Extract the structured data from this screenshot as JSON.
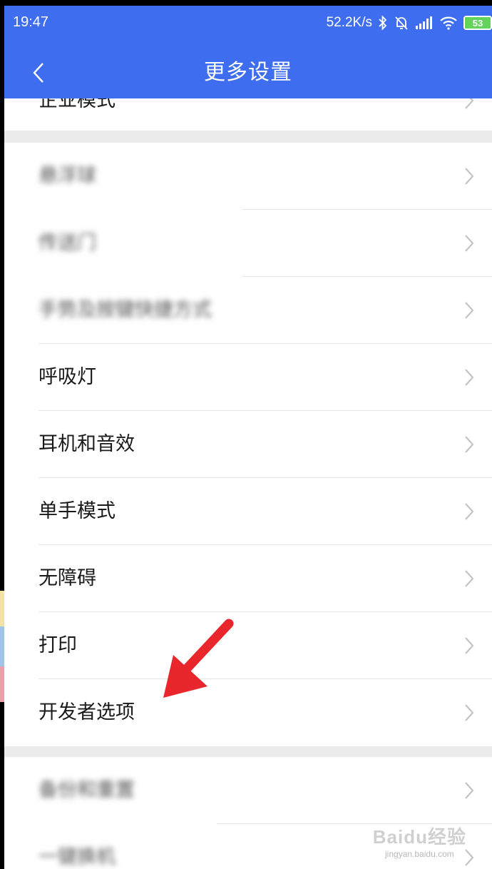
{
  "status_bar": {
    "time": "19:47",
    "net_speed": "52.2K/s",
    "battery_level": "53",
    "icons": [
      "bluetooth-icon",
      "mute-bell-icon",
      "signal-icon",
      "wifi-icon",
      "battery-icon"
    ]
  },
  "header": {
    "title": "更多设置",
    "back_icon": "chevron-left-icon",
    "background_color": "#3e6df0"
  },
  "top_partial_item": {
    "label": "企业模式"
  },
  "group1": {
    "items": [
      {
        "label": "悬浮球",
        "blurred": true
      },
      {
        "label": "传送门",
        "blurred": true
      },
      {
        "label": "手势及按键快捷方式",
        "blurred": true
      },
      {
        "label": "呼吸灯",
        "blurred": false
      },
      {
        "label": "耳机和音效",
        "blurred": false
      },
      {
        "label": "单手模式",
        "blurred": false
      },
      {
        "label": "无障碍",
        "blurred": false
      },
      {
        "label": "打印",
        "blurred": false
      },
      {
        "label": "开发者选项",
        "blurred": false
      }
    ]
  },
  "group2": {
    "items": [
      {
        "label": "备份和重置",
        "blurred": true
      },
      {
        "label": "一键换机",
        "blurred": true
      }
    ]
  },
  "annotation": {
    "arrow_color": "#e8262b",
    "target": "开发者选项"
  },
  "watermark": {
    "logo": "Baidu经验",
    "site": "jingyan.baidu.com"
  }
}
